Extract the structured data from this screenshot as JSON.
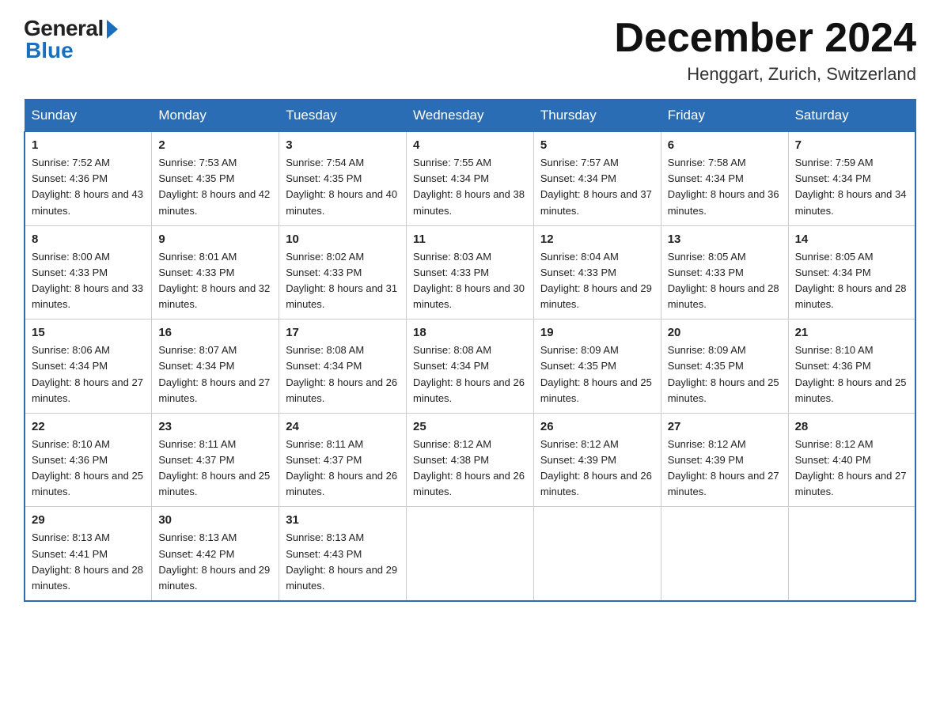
{
  "header": {
    "logo_general": "General",
    "logo_blue": "Blue",
    "month_title": "December 2024",
    "location": "Henggart, Zurich, Switzerland"
  },
  "days_of_week": [
    "Sunday",
    "Monday",
    "Tuesday",
    "Wednesday",
    "Thursday",
    "Friday",
    "Saturday"
  ],
  "weeks": [
    [
      {
        "day": "1",
        "sunrise": "7:52 AM",
        "sunset": "4:36 PM",
        "daylight": "8 hours and 43 minutes."
      },
      {
        "day": "2",
        "sunrise": "7:53 AM",
        "sunset": "4:35 PM",
        "daylight": "8 hours and 42 minutes."
      },
      {
        "day": "3",
        "sunrise": "7:54 AM",
        "sunset": "4:35 PM",
        "daylight": "8 hours and 40 minutes."
      },
      {
        "day": "4",
        "sunrise": "7:55 AM",
        "sunset": "4:34 PM",
        "daylight": "8 hours and 38 minutes."
      },
      {
        "day": "5",
        "sunrise": "7:57 AM",
        "sunset": "4:34 PM",
        "daylight": "8 hours and 37 minutes."
      },
      {
        "day": "6",
        "sunrise": "7:58 AM",
        "sunset": "4:34 PM",
        "daylight": "8 hours and 36 minutes."
      },
      {
        "day": "7",
        "sunrise": "7:59 AM",
        "sunset": "4:34 PM",
        "daylight": "8 hours and 34 minutes."
      }
    ],
    [
      {
        "day": "8",
        "sunrise": "8:00 AM",
        "sunset": "4:33 PM",
        "daylight": "8 hours and 33 minutes."
      },
      {
        "day": "9",
        "sunrise": "8:01 AM",
        "sunset": "4:33 PM",
        "daylight": "8 hours and 32 minutes."
      },
      {
        "day": "10",
        "sunrise": "8:02 AM",
        "sunset": "4:33 PM",
        "daylight": "8 hours and 31 minutes."
      },
      {
        "day": "11",
        "sunrise": "8:03 AM",
        "sunset": "4:33 PM",
        "daylight": "8 hours and 30 minutes."
      },
      {
        "day": "12",
        "sunrise": "8:04 AM",
        "sunset": "4:33 PM",
        "daylight": "8 hours and 29 minutes."
      },
      {
        "day": "13",
        "sunrise": "8:05 AM",
        "sunset": "4:33 PM",
        "daylight": "8 hours and 28 minutes."
      },
      {
        "day": "14",
        "sunrise": "8:05 AM",
        "sunset": "4:34 PM",
        "daylight": "8 hours and 28 minutes."
      }
    ],
    [
      {
        "day": "15",
        "sunrise": "8:06 AM",
        "sunset": "4:34 PM",
        "daylight": "8 hours and 27 minutes."
      },
      {
        "day": "16",
        "sunrise": "8:07 AM",
        "sunset": "4:34 PM",
        "daylight": "8 hours and 27 minutes."
      },
      {
        "day": "17",
        "sunrise": "8:08 AM",
        "sunset": "4:34 PM",
        "daylight": "8 hours and 26 minutes."
      },
      {
        "day": "18",
        "sunrise": "8:08 AM",
        "sunset": "4:34 PM",
        "daylight": "8 hours and 26 minutes."
      },
      {
        "day": "19",
        "sunrise": "8:09 AM",
        "sunset": "4:35 PM",
        "daylight": "8 hours and 25 minutes."
      },
      {
        "day": "20",
        "sunrise": "8:09 AM",
        "sunset": "4:35 PM",
        "daylight": "8 hours and 25 minutes."
      },
      {
        "day": "21",
        "sunrise": "8:10 AM",
        "sunset": "4:36 PM",
        "daylight": "8 hours and 25 minutes."
      }
    ],
    [
      {
        "day": "22",
        "sunrise": "8:10 AM",
        "sunset": "4:36 PM",
        "daylight": "8 hours and 25 minutes."
      },
      {
        "day": "23",
        "sunrise": "8:11 AM",
        "sunset": "4:37 PM",
        "daylight": "8 hours and 25 minutes."
      },
      {
        "day": "24",
        "sunrise": "8:11 AM",
        "sunset": "4:37 PM",
        "daylight": "8 hours and 26 minutes."
      },
      {
        "day": "25",
        "sunrise": "8:12 AM",
        "sunset": "4:38 PM",
        "daylight": "8 hours and 26 minutes."
      },
      {
        "day": "26",
        "sunrise": "8:12 AM",
        "sunset": "4:39 PM",
        "daylight": "8 hours and 26 minutes."
      },
      {
        "day": "27",
        "sunrise": "8:12 AM",
        "sunset": "4:39 PM",
        "daylight": "8 hours and 27 minutes."
      },
      {
        "day": "28",
        "sunrise": "8:12 AM",
        "sunset": "4:40 PM",
        "daylight": "8 hours and 27 minutes."
      }
    ],
    [
      {
        "day": "29",
        "sunrise": "8:13 AM",
        "sunset": "4:41 PM",
        "daylight": "8 hours and 28 minutes."
      },
      {
        "day": "30",
        "sunrise": "8:13 AM",
        "sunset": "4:42 PM",
        "daylight": "8 hours and 29 minutes."
      },
      {
        "day": "31",
        "sunrise": "8:13 AM",
        "sunset": "4:43 PM",
        "daylight": "8 hours and 29 minutes."
      },
      null,
      null,
      null,
      null
    ]
  ]
}
